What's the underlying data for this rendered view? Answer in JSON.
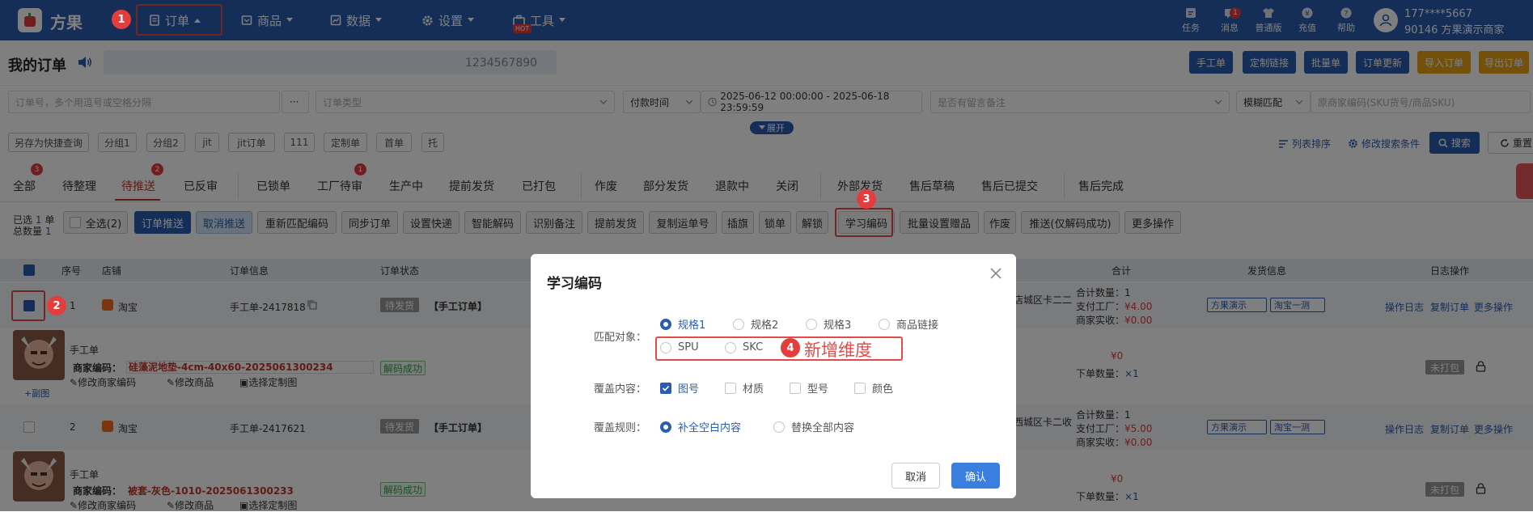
{
  "topbar": {
    "logo_text": "方果",
    "nav": [
      {
        "label": "订单"
      },
      {
        "label": "商品"
      },
      {
        "label": "数据"
      },
      {
        "label": "设置"
      },
      {
        "label": "工具"
      }
    ],
    "hot_label": "HOT",
    "icons": [
      {
        "label": "任务",
        "icon": "task-icon"
      },
      {
        "label": "消息",
        "icon": "message-icon"
      },
      {
        "label": "普通版",
        "icon": "shirt-icon"
      },
      {
        "label": "充值",
        "icon": "recharge-icon"
      },
      {
        "label": "帮助",
        "icon": "help-icon"
      }
    ],
    "message_badge": "1",
    "user_phone": "177****5667",
    "user_shop": "90146 方果演示商家"
  },
  "header": {
    "title": "我的订单",
    "notice_text": "1234567890",
    "buttons": [
      "手工单",
      "定制链接",
      "批量单",
      "订单更新"
    ],
    "yellow_buttons": [
      "导入订单",
      "导出订单"
    ]
  },
  "filters": {
    "order_no_placeholder": "订单号，多个用逗号或空格分隔",
    "more": "···",
    "order_type_placeholder": "订单类型",
    "time_type": "付款时间",
    "date_range": "2025-06-12 00:00:00  -  2025-06-18 23:59:59",
    "remark_placeholder": "是否有留言备注",
    "match_mode": "模糊匹配",
    "sku_placeholder": "原商家编码(SKU货号/商品SKU)",
    "expand_label": "展开",
    "chips": [
      "另存为快捷查询",
      "分组1",
      "分组2",
      "jit",
      "jit订单",
      "111",
      "定制单",
      "首单",
      "托"
    ],
    "column_sort": "列表排序",
    "edit_conditions": "修改搜索条件",
    "search": "搜索",
    "reset": "重置"
  },
  "tabs": {
    "items": [
      "全部",
      "待整理",
      "待推送",
      "已反审",
      "已锁单",
      "工厂待审",
      "生产中",
      "提前发货",
      "已打包",
      "作废",
      "部分发货",
      "退款中",
      "关闭",
      "外部发货",
      "售后草稿",
      "售后已提交",
      "售后完成"
    ],
    "badges": {
      "all": "3",
      "push": "2",
      "factory": "1"
    }
  },
  "actions": {
    "selected_label": "已选",
    "selected_count": "1",
    "selected_unit": "单",
    "total_label": "总数量",
    "total_count": "1",
    "select_all": "全选(2)",
    "buttons": [
      "订单推送",
      "取消推送",
      "重新匹配编码",
      "同步订单",
      "设置快递",
      "智能解码",
      "识别备注",
      "提前发货",
      "复制运单号",
      "插旗",
      "锁单",
      "解锁",
      "学习编码",
      "批量设置赠品",
      "作废",
      "推送(仅解码成功)",
      "更多操作"
    ]
  },
  "table": {
    "headers": [
      "序号",
      "店铺",
      "订单信息",
      "订单状态",
      "合计",
      "发货信息",
      "日志操作"
    ],
    "rows": [
      {
        "index": "1",
        "shop": "淘宝",
        "order_no": "手工单-2417818",
        "status": "待发货",
        "order_tag": "【手工订单】",
        "address": "店城区卡二二",
        "total_qty": "合计数量：1",
        "factory_pay": "支付工厂：",
        "factory_amount": "¥4.00",
        "merchant_recv": "商家实收：",
        "merchant_amount": "¥0.00",
        "ship1": "方果演示",
        "ship2": "淘宝一测",
        "logs": [
          "操作日志",
          "复制订单",
          "更多操作"
        ],
        "item_title": "手工单",
        "code_label": "商家编码：",
        "code": "硅藻泥地垫-4cm-40x60-2025061300234",
        "decode_status": "解码成功",
        "sub_link": "+副图",
        "edit_code": "修改商家编码",
        "edit_goods": "修改商品",
        "choose_custom": "选择定制图",
        "price": "¥0",
        "order_qty_label": "下单数量：",
        "order_qty": "×1",
        "pack_tag": "未打包"
      },
      {
        "index": "2",
        "shop": "淘宝",
        "order_no": "手工单-2417621",
        "status": "待发货",
        "order_tag": "【手工订单】",
        "address": "西城区卡二收",
        "total_qty": "合计数量：1",
        "factory_pay": "支付工厂：",
        "factory_amount": "¥5.00",
        "merchant_recv": "商家实收：",
        "merchant_amount": "¥0.00",
        "ship1": "方果演示",
        "ship2": "淘宝一测",
        "logs": [
          "操作日志",
          "复制订单",
          "更多操作"
        ],
        "item_title": "手工单",
        "code_label": "商家编码：",
        "code": "被套-灰色-1010-2025061300233",
        "decode_status": "解码成功",
        "edit_code": "修改商家编码",
        "edit_goods": "修改商品",
        "choose_custom": "选择定制图",
        "price": "¥0",
        "order_qty_label": "下单数量：",
        "order_qty": "×1",
        "pack_tag": "未打包"
      }
    ]
  },
  "modal": {
    "title": "学习编码",
    "match_label": "匹配对象：",
    "match_options": [
      "规格1",
      "规格2",
      "规格3",
      "商品链接",
      "SPU",
      "SKC"
    ],
    "cover_label": "覆盖内容：",
    "cover_options": [
      "图号",
      "材质",
      "型号",
      "颜色"
    ],
    "rule_label": "覆盖规则：",
    "rule_options": [
      "补全空白内容",
      "替换全部内容"
    ],
    "cancel": "取消",
    "confirm": "确认"
  },
  "annotations": {
    "markers": [
      "1",
      "2",
      "3",
      "4"
    ],
    "new_dimension": "新增维度"
  },
  "colors": {
    "primary": "#2a5db0",
    "accent_red": "#e34a4a",
    "warning": "#e8a317"
  }
}
